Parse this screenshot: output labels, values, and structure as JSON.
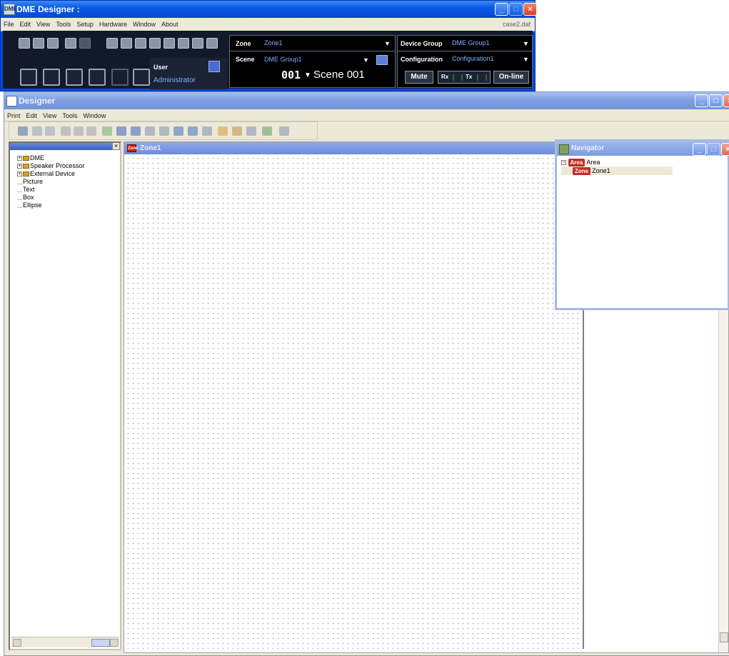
{
  "dme": {
    "title": "DME Designer :",
    "app_icon": "DME",
    "file_name": "case2.daf",
    "menu": [
      "File",
      "Edit",
      "View",
      "Tools",
      "Setup",
      "Hardware",
      "Window",
      "About"
    ],
    "window_buttons": {
      "minimize": "_",
      "maximize": "□",
      "close": "×"
    },
    "user": {
      "label": "User",
      "value": "Administrator"
    },
    "zone": {
      "label": "Zone",
      "value": "Zone1"
    },
    "scene": {
      "label": "Scene",
      "group": "DME Group1",
      "number": "001",
      "name": "Scene 001"
    },
    "device_group": {
      "label": "Device Group",
      "value": "DME Group1"
    },
    "configuration": {
      "label": "Configuration",
      "value": "Configuration1"
    },
    "status": {
      "mute": "Mute",
      "rx": "Rx",
      "tx": "Tx",
      "online": "On-line"
    },
    "dropdown_glyph": "▼"
  },
  "designer": {
    "title": "Designer",
    "menu": [
      "Print",
      "Edit",
      "View",
      "Tools",
      "Window"
    ],
    "window_buttons": {
      "minimize": "_",
      "maximize": "□",
      "close": "×"
    },
    "tree_close": "×",
    "tree": [
      {
        "label": "DME",
        "type": "folder",
        "expander": "+"
      },
      {
        "label": "Speaker Processor",
        "type": "folder",
        "expander": "+"
      },
      {
        "label": "External Device",
        "type": "folder",
        "expander": "+"
      },
      {
        "label": "Picture",
        "type": "leaf"
      },
      {
        "label": "Text",
        "type": "leaf"
      },
      {
        "label": "Box",
        "type": "leaf"
      },
      {
        "label": "Ellipse",
        "type": "leaf"
      }
    ],
    "zone_window": {
      "title": "Zone1",
      "icon": "Zone"
    }
  },
  "navigator": {
    "title": "Navigator",
    "expander": "−",
    "area": {
      "badge": "Area",
      "label": "Area"
    },
    "zone": {
      "badge": "Zone",
      "label": "Zone1"
    }
  }
}
